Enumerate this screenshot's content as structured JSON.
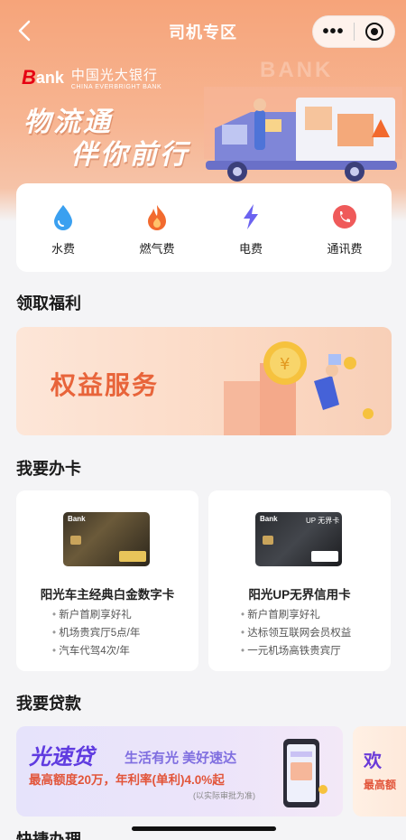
{
  "header": {
    "title": "司机专区",
    "back_icon": "chevron-left-icon",
    "more_glyph": "•••",
    "bank_logo_b": "B",
    "bank_logo_rest": "ank",
    "bank_name_cn": "中国光大银行",
    "bank_name_en": "CHINA EVERBRIGHT BANK",
    "slogan_line1": "物流通",
    "slogan_line2": "伴你前行",
    "watermark": "BANK"
  },
  "services": [
    {
      "label": "水费",
      "icon": "water-drop-icon",
      "color": "#3aa0f0"
    },
    {
      "label": "燃气费",
      "icon": "flame-icon",
      "color": "#f26a2e"
    },
    {
      "label": "电费",
      "icon": "lightning-icon",
      "color": "#6b63f0"
    },
    {
      "label": "通讯费",
      "icon": "phone-icon",
      "color": "#ef5a5a"
    }
  ],
  "sections": {
    "benefits": "领取福利",
    "apply_card": "我要办卡",
    "loan": "我要贷款",
    "next_partial": "快捷办理"
  },
  "benefit_banner": {
    "text": "权益服务"
  },
  "cards": [
    {
      "name": "阳光车主经典白金数字卡",
      "card_brand": "Bank",
      "features": [
        "新户首刷享好礼",
        "机场贵宾厅5点/年",
        "汽车代驾4次/年"
      ]
    },
    {
      "name": "阳光UP无界信用卡",
      "card_brand": "Bank",
      "card_up": "UP 无界卡",
      "features": [
        "新户首刷享好礼",
        "达标领互联网会员权益",
        "一元机场高铁贵宾厅"
      ]
    }
  ],
  "loan_banner": {
    "brand": "光速贷",
    "slogan": "生活有光 美好速达",
    "rate": "最高额度20万，年利率(单利)4.0%起",
    "note": "(以实际审批为准)"
  },
  "loan_banner2": {
    "title": "欢",
    "subtitle": "最高额"
  },
  "colors": {
    "accent": "#f6a47a",
    "red": "#e2553a",
    "purple": "#5f3be0"
  }
}
